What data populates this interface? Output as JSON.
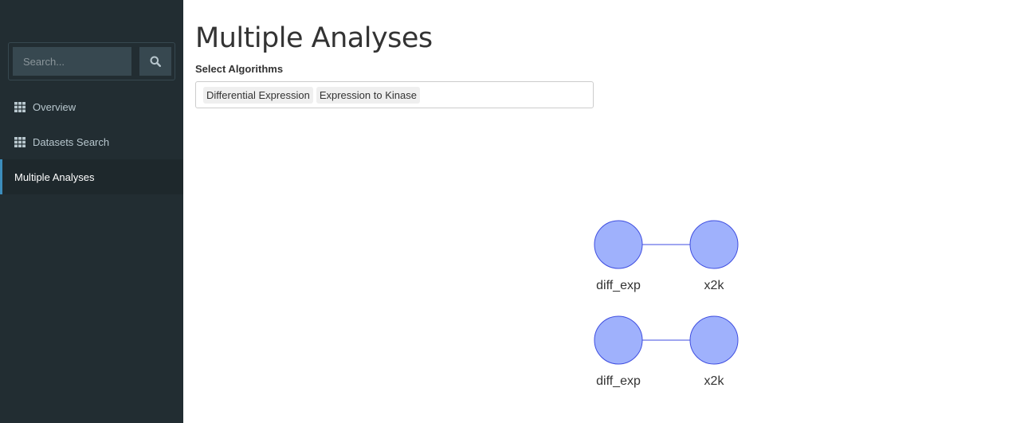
{
  "sidebar": {
    "search": {
      "placeholder": "Search..."
    },
    "items": [
      {
        "label": "Overview",
        "icon": "grid-icon"
      },
      {
        "label": "Datasets Search",
        "icon": "grid-icon"
      },
      {
        "label": "Multiple Analyses",
        "active": true
      }
    ]
  },
  "main": {
    "title": "Multiple Analyses",
    "select": {
      "label": "Select Algorithms",
      "selected": [
        "Differential Expression",
        "Expression to Kinase"
      ]
    }
  },
  "graph": {
    "rows": [
      {
        "nodes": [
          "diff_exp",
          "x2k"
        ]
      },
      {
        "nodes": [
          "diff_exp",
          "x2k"
        ]
      }
    ]
  },
  "colors": {
    "sidebar_bg": "#222d32",
    "active_item_bg": "#1e282c",
    "active_accent": "#3c8dbc",
    "node_fill": "#9fb1fc",
    "node_stroke": "#3f4ee0"
  }
}
